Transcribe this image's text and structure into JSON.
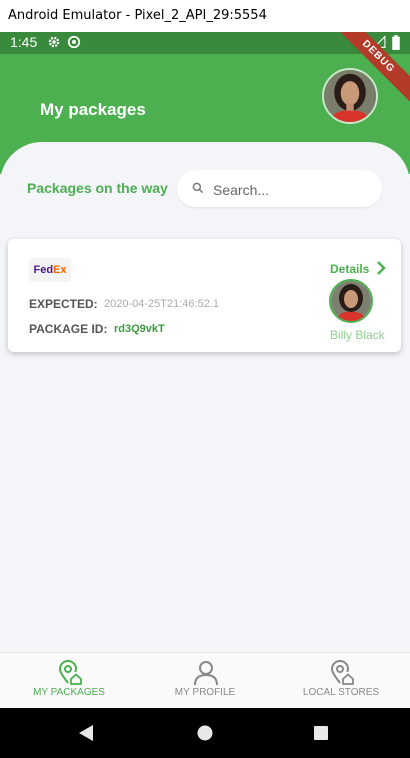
{
  "window": {
    "title": "Android Emulator - Pixel_2_API_29:5554"
  },
  "statusbar": {
    "time": "1:45"
  },
  "debug_banner": "DEBUG",
  "header": {
    "title": "My packages"
  },
  "section": {
    "label": "Packages on the way"
  },
  "search": {
    "placeholder": "Search..."
  },
  "package": {
    "carrier_fe": "Fed",
    "carrier_ex": "Ex",
    "expected_label": "EXPECTED:",
    "expected_value": "2020-04-25T21:46:52.1",
    "id_label": "PACKAGE ID:",
    "id_value": "rd3Q9vkT",
    "details_label": "Details",
    "courier_name": "Billy Black"
  },
  "bottom_nav": {
    "items": [
      {
        "label": "MY PACKAGES",
        "active": true
      },
      {
        "label": "MY PROFILE",
        "active": false
      },
      {
        "label": "LOCAL STORES",
        "active": false
      }
    ]
  },
  "colors": {
    "primary": "#4caf50",
    "status_bar": "#3a8a3d",
    "background": "#f4f5f9",
    "debug": "#b23b2a"
  }
}
